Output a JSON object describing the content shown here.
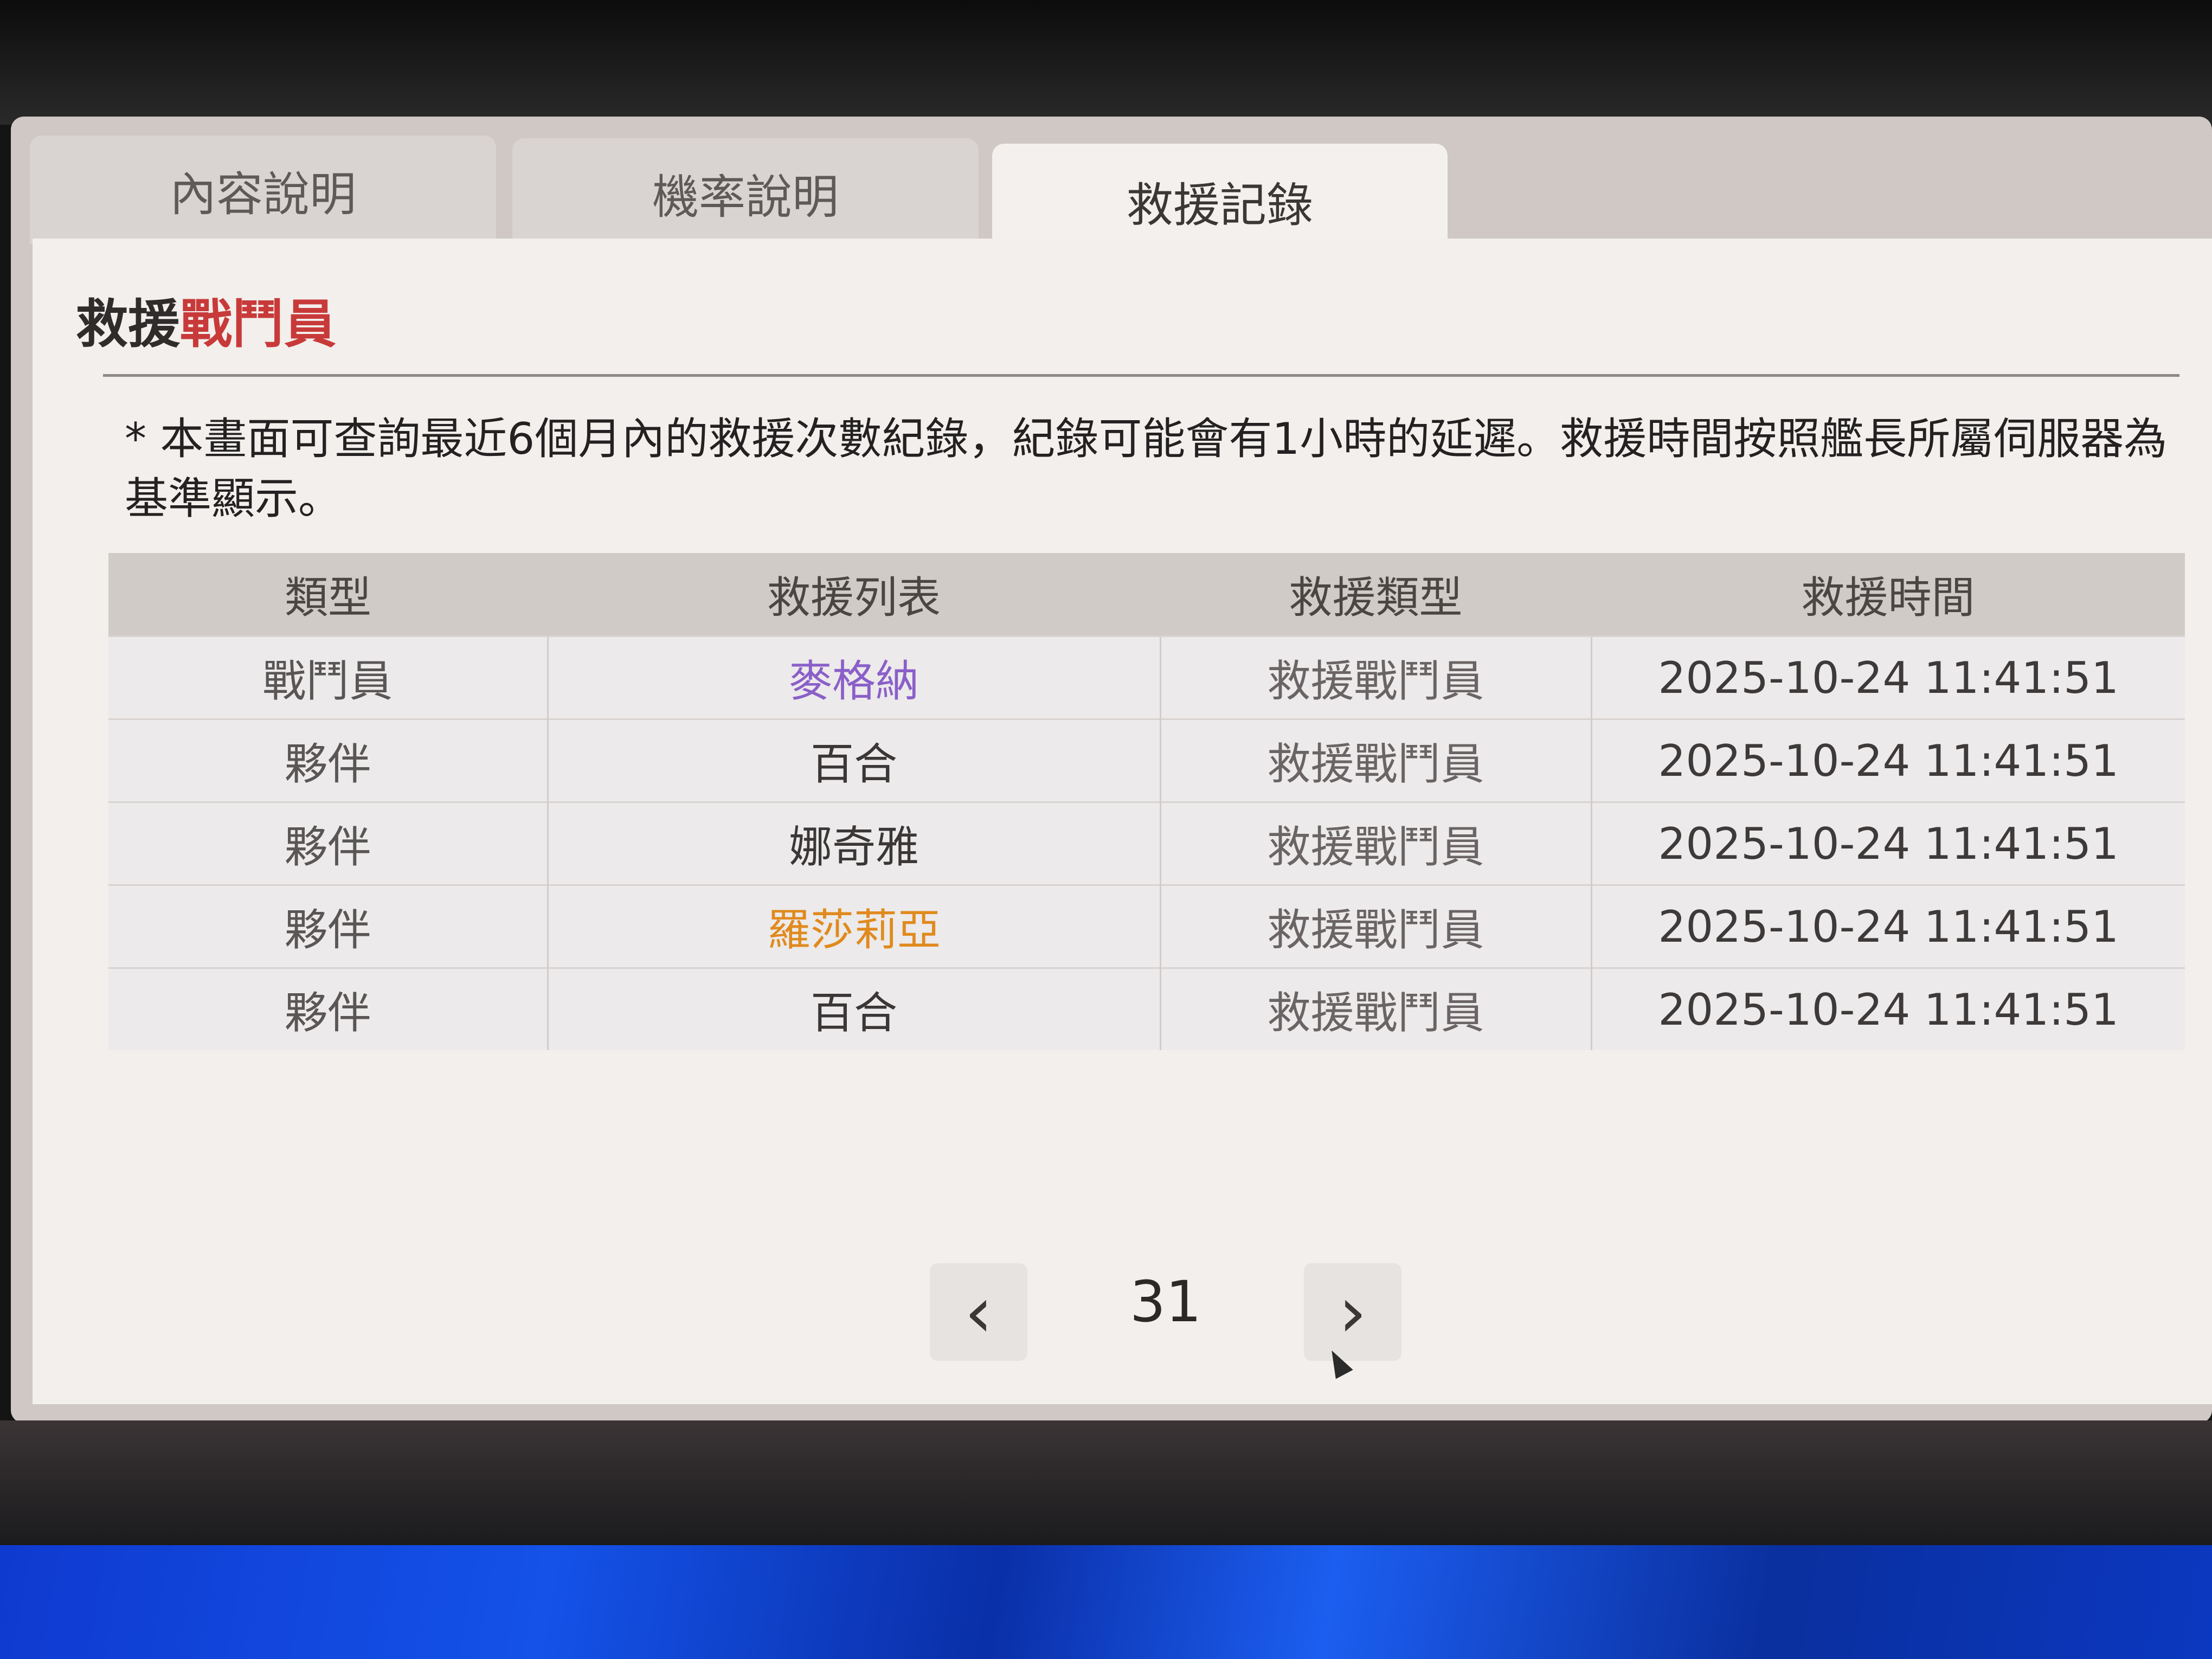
{
  "tabs": [
    {
      "label": "內容說明",
      "active": false
    },
    {
      "label": "機率說明",
      "active": false
    },
    {
      "label": "救援記錄",
      "active": true
    }
  ],
  "section": {
    "title_prefix": "救援",
    "title_accent": "戰鬥員",
    "accent_color": "#c83a3a"
  },
  "notice": "* 本畫面可查詢最近6個月內的救援次數紀錄，紀錄可能會有1小時的延遲。救援時間按照艦長所屬伺服器為基準顯示。",
  "table": {
    "headers": [
      "類型",
      "救援列表",
      "救援類型",
      "救援時間"
    ],
    "rows": [
      {
        "type": "戰鬥員",
        "name": "麥格納",
        "name_color": "#8a5fc9",
        "kind": "救援戰鬥員",
        "time": "2025-10-24 11:41:51"
      },
      {
        "type": "夥伴",
        "name": "百合",
        "name_color": "#3a3736",
        "kind": "救援戰鬥員",
        "time": "2025-10-24 11:41:51"
      },
      {
        "type": "夥伴",
        "name": "娜奇雅",
        "name_color": "#3a3736",
        "kind": "救援戰鬥員",
        "time": "2025-10-24 11:41:51"
      },
      {
        "type": "夥伴",
        "name": "羅莎莉亞",
        "name_color": "#e08a1e",
        "kind": "救援戰鬥員",
        "time": "2025-10-24 11:41:51"
      },
      {
        "type": "夥伴",
        "name": "百合",
        "name_color": "#3a3736",
        "kind": "救援戰鬥員",
        "time": "2025-10-24 11:41:51"
      }
    ]
  },
  "pager": {
    "prev_icon": "chevron-left-icon",
    "next_icon": "chevron-right-icon",
    "page": "31"
  }
}
